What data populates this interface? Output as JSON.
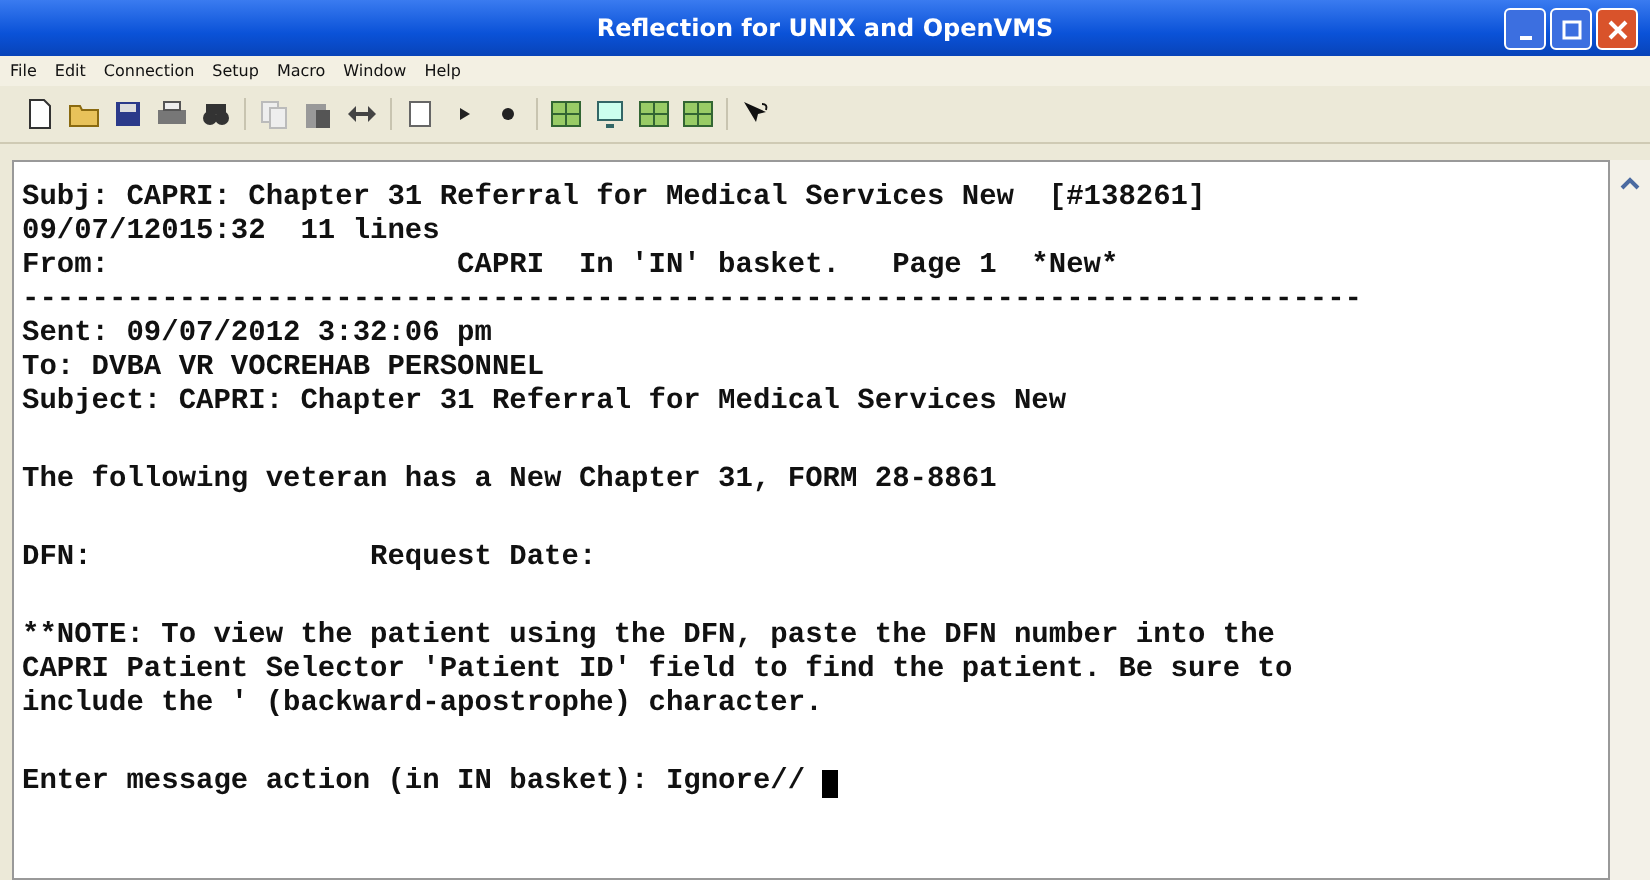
{
  "window": {
    "title": "Reflection for UNIX and OpenVMS"
  },
  "menu": [
    "File",
    "Edit",
    "Connection",
    "Setup",
    "Macro",
    "Window",
    "Help"
  ],
  "terminal": {
    "groups": [
      [
        "Subj: CAPRI: Chapter 31 Referral for Medical Services New  [#138261]",
        "09/07/12015:32  11 lines",
        "From:                    CAPRI  In 'IN' basket.   Page 1  *New*",
        "-----------------------------------------------------------------------------",
        "Sent: 09/07/2012 3:32:06 pm",
        "To: DVBA VR VOCREHAB PERSONNEL",
        "Subject: CAPRI: Chapter 31 Referral for Medical Services New"
      ],
      [
        "The following veteran has a New Chapter 31, FORM 28-8861"
      ],
      [
        "DFN:                Request Date:"
      ],
      [
        "**NOTE: To view the patient using the DFN, paste the DFN number into the",
        "CAPRI Patient Selector 'Patient ID' field to find the patient. Be sure to",
        "include the ' (backward-apostrophe) character."
      ],
      [
        "Enter message action (in IN basket): Ignore// "
      ]
    ]
  }
}
